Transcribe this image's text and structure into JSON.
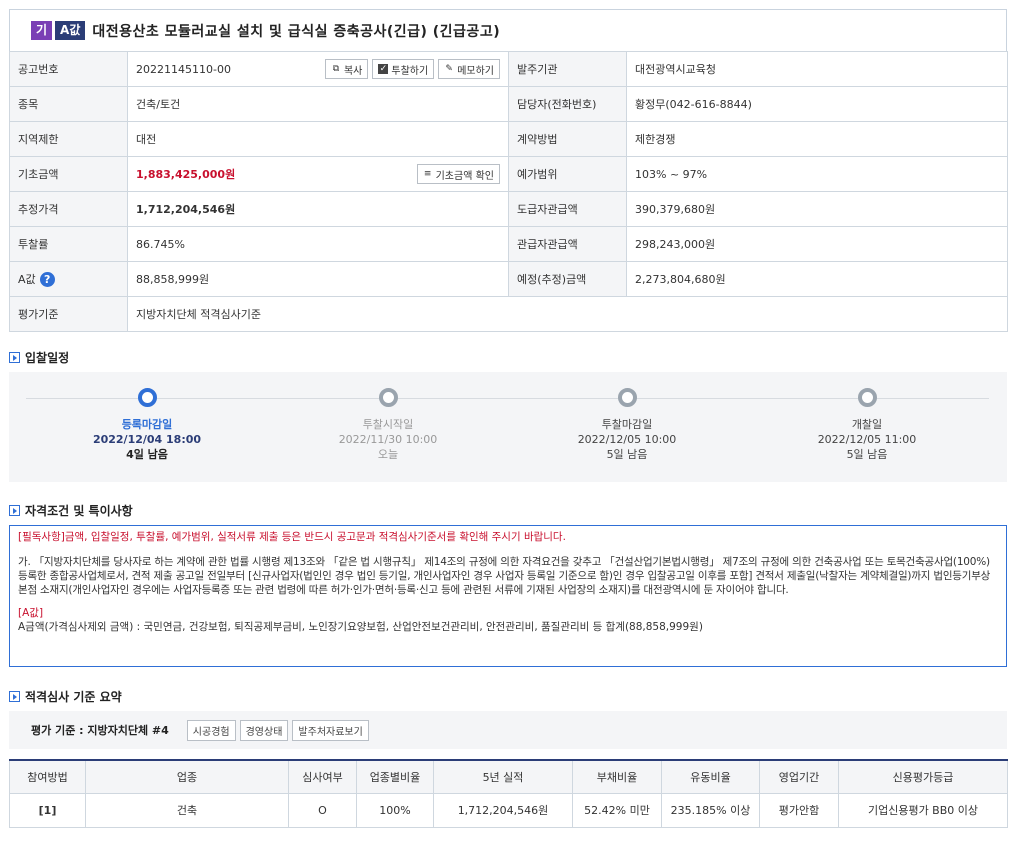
{
  "header": {
    "badge1": "기",
    "badge2": "A값",
    "title": "대전용산초 모듈러교실 설치 및 급식실 증축공사(긴급) (긴급공고)"
  },
  "info": {
    "notice_no_label": "공고번호",
    "notice_no": "20221145110-00",
    "copy_btn": "복사",
    "bid_btn": "투찰하기",
    "memo_btn": "메모하기",
    "agency_label": "발주기관",
    "agency": "대전광역시교육청",
    "type_label": "종목",
    "type": "건축/토건",
    "contact_label": "담당자(전화번호)",
    "contact": "황정무(042-616-8844)",
    "region_label": "지역제한",
    "region": "대전",
    "method_label": "계약방법",
    "method": "제한경쟁",
    "base_label": "기초금액",
    "base": "1,883,425,000원",
    "base_btn": "기초금액 확인",
    "range_label": "예가범위",
    "range": "103% ~ 97%",
    "est_label": "추정가격",
    "est": "1,712,204,546원",
    "supply_label": "도급자관급액",
    "supply": "390,379,680원",
    "rate_label": "투찰률",
    "rate": "86.745%",
    "gov_supply_label": "관급자관급액",
    "gov_supply": "298,243,000원",
    "a_label": "A값",
    "a_value": "88,858,999원",
    "planned_label": "예정(추정)금액",
    "planned": "2,273,804,680원",
    "eval_label": "평가기준",
    "eval": "지방자치단체 적격심사기준"
  },
  "schedule": {
    "title": "입찰일정",
    "steps": [
      {
        "name": "등록마감일",
        "date": "2022/12/04 18:00",
        "remain": "4일 남음"
      },
      {
        "name": "투찰시작일",
        "date": "2022/11/30 10:00",
        "remain": "오늘"
      },
      {
        "name": "투찰마감일",
        "date": "2022/12/05 10:00",
        "remain": "5일 남음"
      },
      {
        "name": "개찰일",
        "date": "2022/12/05 11:00",
        "remain": "5일 남음"
      }
    ]
  },
  "qualification": {
    "title": "자격조건 및 특이사항",
    "must": "[필독사항]금액, 입찰일정, 투찰률, 예가범위, 실적서류 제출 등은 반드시 공고문과 적격심사기준서를 확인해 주시기 바랍니다.",
    "body": "가. 「지방자치단체를 당사자로 하는 계약에 관한 법률 시행령 제13조와 「같은 법 시행규칙」 제14조의 규정에 의한 자격요건을 갖추고 「건설산업기본법시행령」 제7조의 규정에 의한 건축공사업 또는 토목건축공사업(100%) 등록한 종합공사업체로서, 견적 제출 공고일 전일부터 [신규사업자(법인인 경우 법인 등기일, 개인사업자인 경우 사업자 등록일 기준으로 함)인 경우 입찰공고일 이후를 포함] 견적서 제출일(낙찰자는 계약체결일)까지 법인등기부상 본점 소재지(개인사업자인 경우에는 사업자등록증 또는 관련 법령에 따른 허가·인가·면허·등록·신고 등에 관련된 서류에 기재된 사업장의 소재지)를 대전광역시에 둔 자이어야 합니다.",
    "a_head": "[A값]",
    "a_text": "A금액(가격심사제외 금액) : 국민연금, 건강보험, 퇴직공제부금비, 노인장기요양보험, 산업안전보건관리비, 안전관리비, 품질관리비 등 합계(88,858,999원)"
  },
  "criteria": {
    "title": "적격심사 기준 요약",
    "label": "평가 기준 : 지방자치단체 #4",
    "buttons": [
      "시공경험",
      "경영상태",
      "발주처자료보기"
    ],
    "headers": [
      "참여방법",
      "업종",
      "심사여부",
      "업종별비율",
      "5년 실적",
      "부채비율",
      "유동비율",
      "영업기간",
      "신용평가등급"
    ],
    "row": [
      "[1]",
      "건축",
      "O",
      "100%",
      "1,712,204,546원",
      "52.42% 미만",
      "235.185% 이상",
      "평가안함",
      "기업신용평가 BB0 이상"
    ]
  },
  "colors": {
    "accent": "#2f6fd6",
    "red": "#c8102e",
    "navy": "#2b3d77",
    "purple": "#7a3fb5"
  }
}
